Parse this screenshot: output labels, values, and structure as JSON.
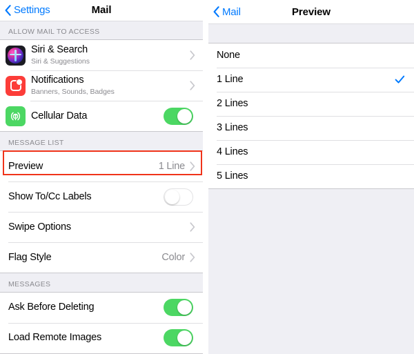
{
  "left": {
    "nav": {
      "back_label": "Settings",
      "back_icon": "chevron-left-icon",
      "title": "Mail"
    },
    "sections": [
      {
        "header": "ALLOW MAIL TO ACCESS",
        "rows": [
          {
            "title": "Siri & Search",
            "subtitle": "Siri & Suggestions",
            "icon": "siri-icon",
            "accessory": "chevron-right-icon"
          },
          {
            "title": "Notifications",
            "subtitle": "Banners, Sounds, Badges",
            "icon": "notifications-icon",
            "accessory": "chevron-right-icon"
          },
          {
            "title": "Cellular Data",
            "subtitle": "",
            "icon": "cellular-data-icon",
            "accessory": "toggle",
            "toggle_state": "on"
          }
        ]
      },
      {
        "header": "MESSAGE LIST",
        "rows": [
          {
            "title": "Preview",
            "value": "1 Line",
            "accessory": "chevron-right-icon",
            "highlighted": true
          },
          {
            "title": "Show To/Cc Labels",
            "accessory": "toggle",
            "toggle_state": "off"
          },
          {
            "title": "Swipe Options",
            "accessory": "chevron-right-icon"
          },
          {
            "title": "Flag Style",
            "value": "Color",
            "accessory": "chevron-right-icon"
          }
        ]
      },
      {
        "header": "MESSAGES",
        "rows": [
          {
            "title": "Ask Before Deleting",
            "accessory": "toggle",
            "toggle_state": "on"
          },
          {
            "title": "Load Remote Images",
            "accessory": "toggle",
            "toggle_state": "on"
          }
        ]
      }
    ]
  },
  "right": {
    "nav": {
      "back_label": "Mail",
      "back_icon": "chevron-left-icon",
      "title": "Preview"
    },
    "options": [
      {
        "label": "None",
        "selected": false
      },
      {
        "label": "1 Line",
        "selected": true
      },
      {
        "label": "2 Lines",
        "selected": false
      },
      {
        "label": "3 Lines",
        "selected": false
      },
      {
        "label": "4 Lines",
        "selected": false
      },
      {
        "label": "5 Lines",
        "selected": false
      }
    ],
    "check_icon": "checkmark-icon"
  },
  "colors": {
    "accent_blue": "#007aff",
    "toggle_on_green": "#4cd763",
    "highlight_red": "#f0331a",
    "group_background": "#ffffff",
    "page_background": "#efeff4",
    "secondary_text": "#8a8a8f"
  }
}
